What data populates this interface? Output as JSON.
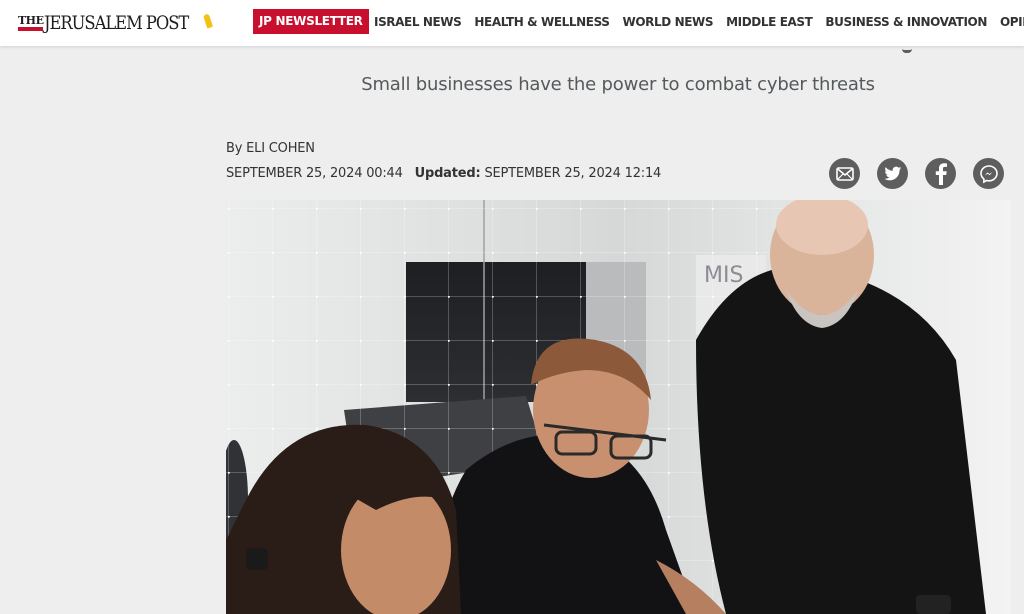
{
  "header": {
    "logo": {
      "the": "THE",
      "name": "JERUSALEM POST"
    },
    "newsletter_label": "JP NEWSLETTER",
    "nav": [
      {
        "label": "ISRAEL NEWS"
      },
      {
        "label": "HEALTH & WELLNESS"
      },
      {
        "label": "WORLD NEWS"
      },
      {
        "label": "MIDDLE EAST"
      },
      {
        "label": "BUSINESS & INNOVATION"
      },
      {
        "label": "OPINION"
      }
    ],
    "brand_color": "#c8102e"
  },
  "article": {
    "subtitle": "Small businesses have the power to combat cyber threats",
    "byline_prefix": "By",
    "author": "ELI COHEN",
    "published": "SEPTEMBER 25, 2024 00:44",
    "updated_label": "Updated:",
    "updated": "SEPTEMBER 25, 2024 12:14",
    "share_icons": [
      "email-icon",
      "twitter-icon",
      "facebook-icon",
      "messenger-icon"
    ],
    "photo_sign_text": "MIS"
  }
}
